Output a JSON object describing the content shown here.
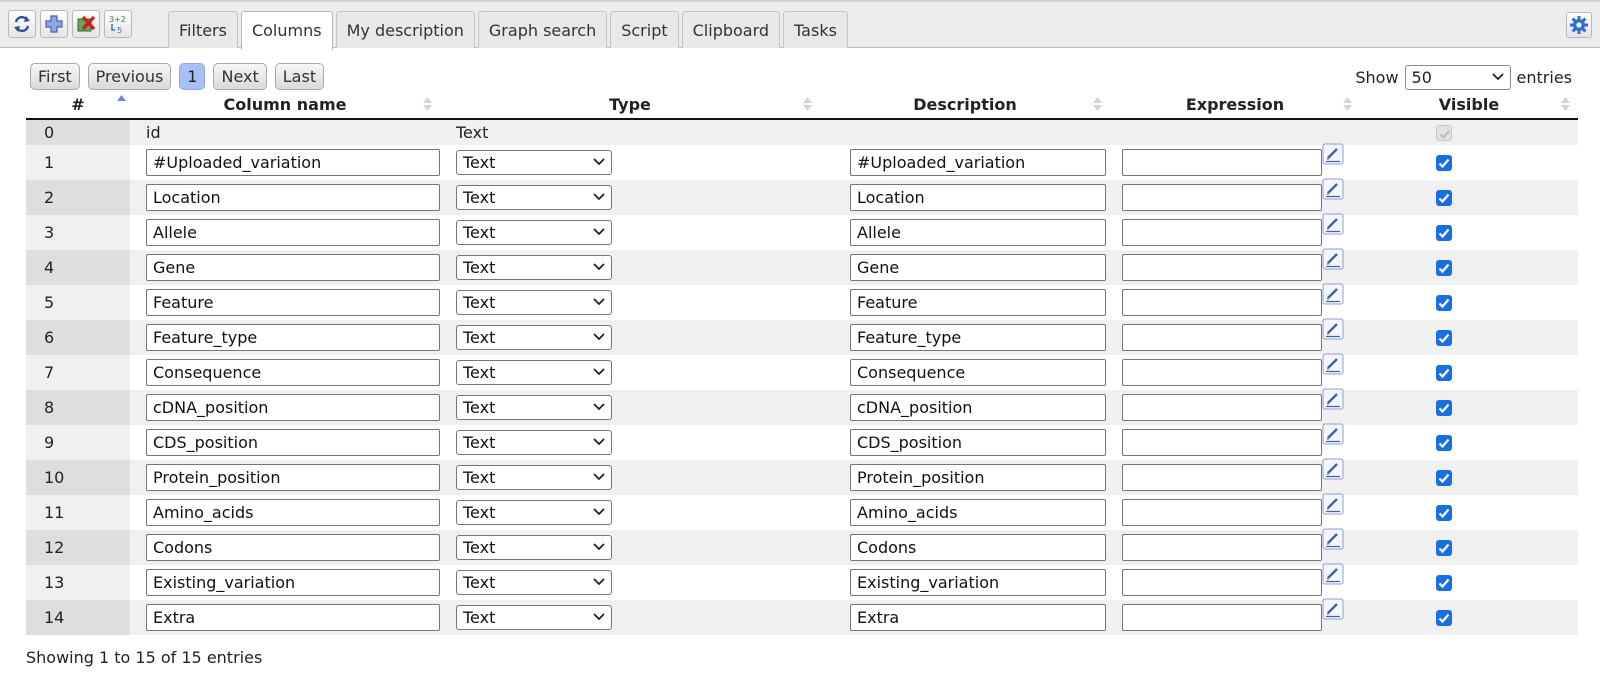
{
  "toolbar": {
    "icons": [
      "refresh-icon",
      "add-icon",
      "delete-icon",
      "compute-icon"
    ],
    "compute_icon_text": "3+2",
    "compute_icon_text2": "5"
  },
  "tabs": [
    "Filters",
    "Columns",
    "My description",
    "Graph search",
    "Script",
    "Clipboard",
    "Tasks"
  ],
  "active_tab": "Columns",
  "pagination": {
    "first": "First",
    "previous": "Previous",
    "current": "1",
    "next": "Next",
    "last": "Last"
  },
  "length": {
    "show": "Show",
    "value": "50",
    "entries": "entries"
  },
  "table": {
    "headers": [
      "#",
      "Column name",
      "Type",
      "Description",
      "Expression",
      "Visible"
    ],
    "rows": [
      {
        "num": "0",
        "name": "id",
        "type": "Text",
        "description": "",
        "expression": "",
        "visible": true,
        "editable": false
      },
      {
        "num": "1",
        "name": "#Uploaded_variation",
        "type": "Text",
        "description": "#Uploaded_variation",
        "expression": "",
        "visible": true,
        "editable": true
      },
      {
        "num": "2",
        "name": "Location",
        "type": "Text",
        "description": "Location",
        "expression": "",
        "visible": true,
        "editable": true
      },
      {
        "num": "3",
        "name": "Allele",
        "type": "Text",
        "description": "Allele",
        "expression": "",
        "visible": true,
        "editable": true
      },
      {
        "num": "4",
        "name": "Gene",
        "type": "Text",
        "description": "Gene",
        "expression": "",
        "visible": true,
        "editable": true
      },
      {
        "num": "5",
        "name": "Feature",
        "type": "Text",
        "description": "Feature",
        "expression": "",
        "visible": true,
        "editable": true
      },
      {
        "num": "6",
        "name": "Feature_type",
        "type": "Text",
        "description": "Feature_type",
        "expression": "",
        "visible": true,
        "editable": true
      },
      {
        "num": "7",
        "name": "Consequence",
        "type": "Text",
        "description": "Consequence",
        "expression": "",
        "visible": true,
        "editable": true
      },
      {
        "num": "8",
        "name": "cDNA_position",
        "type": "Text",
        "description": "cDNA_position",
        "expression": "",
        "visible": true,
        "editable": true
      },
      {
        "num": "9",
        "name": "CDS_position",
        "type": "Text",
        "description": "CDS_position",
        "expression": "",
        "visible": true,
        "editable": true
      },
      {
        "num": "10",
        "name": "Protein_position",
        "type": "Text",
        "description": "Protein_position",
        "expression": "",
        "visible": true,
        "editable": true
      },
      {
        "num": "11",
        "name": "Amino_acids",
        "type": "Text",
        "description": "Amino_acids",
        "expression": "",
        "visible": true,
        "editable": true
      },
      {
        "num": "12",
        "name": "Codons",
        "type": "Text",
        "description": "Codons",
        "expression": "",
        "visible": true,
        "editable": true
      },
      {
        "num": "13",
        "name": "Existing_variation",
        "type": "Text",
        "description": "Existing_variation",
        "expression": "",
        "visible": true,
        "editable": true
      },
      {
        "num": "14",
        "name": "Extra",
        "type": "Text",
        "description": "Extra",
        "expression": "",
        "visible": true,
        "editable": true
      }
    ]
  },
  "info": "Showing 1 to 15 of 15 entries",
  "colors": {
    "accent": "#1a6fe0",
    "current_page": "#a9bff5",
    "row_stripe": "#f0f0f0",
    "sort_arrow_active": "#6f86e0"
  }
}
